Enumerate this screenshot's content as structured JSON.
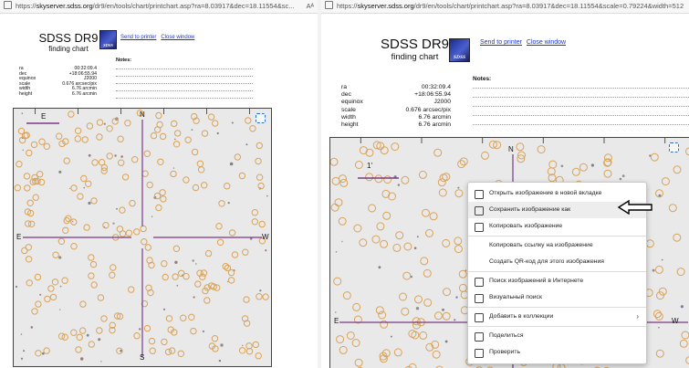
{
  "left": {
    "url": {
      "prefix": "https://",
      "domain": "skyserver.sdss.org",
      "path": "/dr9/en/tools/chart/printchart.asp?ra=8.03917&dec=18.11554&sc...",
      "reader_icon": "Aᴬ"
    },
    "title": "SDSS DR9",
    "subtitle": "finding chart",
    "logo_text": "SDSS",
    "links": [
      "Send to printer",
      "Close window"
    ],
    "notes_label": "Notes:",
    "params": [
      {
        "key": "ra",
        "value": "00:32:09.4"
      },
      {
        "key": "dec",
        "value": "+18:06:55.94"
      },
      {
        "key": "equinox",
        "value": "J2000"
      },
      {
        "key": "scale",
        "value": "0.676 arcsec/pix"
      },
      {
        "key": "width",
        "value": "6.76 arcmin"
      },
      {
        "key": "height",
        "value": "6.76 arcmin"
      }
    ],
    "compass": {
      "n": "N",
      "s": "S",
      "e": "E",
      "w": "W"
    }
  },
  "right": {
    "url": {
      "prefix": "https://",
      "domain": "skyserver.sdss.org",
      "path": "/dr9/en/tools/chart/printchart.asp?ra=8.03917&dec=18.11554&scale=0.79224&width=512"
    },
    "title": "SDSS DR9",
    "subtitle": "finding chart",
    "logo_text": "SDSS",
    "links": [
      "Send to printer",
      "Close window"
    ],
    "notes_label": "Notes:",
    "params": [
      {
        "key": "ra",
        "value": "00:32:09.4"
      },
      {
        "key": "dec",
        "value": "+18:06:55.94"
      },
      {
        "key": "equinox",
        "value": "J2000"
      },
      {
        "key": "scale",
        "value": "0.676 arcsec/pix"
      },
      {
        "key": "width",
        "value": "6.76 arcmin"
      },
      {
        "key": "height",
        "value": "6.76 arcmin"
      }
    ],
    "compass": {
      "n": "N",
      "e": "E",
      "w": "W",
      "one": "1'"
    },
    "context_menu": [
      {
        "label": "Открыть изображение в новой вкладке",
        "icon": "open-new-tab-icon",
        "highlight": false,
        "submenu": false
      },
      {
        "label": "Сохранить изображение как",
        "icon": "save-image-icon",
        "highlight": true,
        "submenu": false
      },
      {
        "label": "Копировать изображение",
        "icon": "copy-image-icon",
        "highlight": false,
        "submenu": false
      },
      {
        "label": "Копировать ссылку на изображение",
        "icon": "",
        "highlight": false,
        "submenu": false
      },
      {
        "label": "Создать QR-код для этого изображения",
        "icon": "",
        "highlight": false,
        "submenu": false
      },
      {
        "label": "Поиск изображений в Интернете",
        "icon": "image-search-icon",
        "highlight": false,
        "submenu": false
      },
      {
        "label": "Визуальный поиск",
        "icon": "visual-search-icon",
        "highlight": false,
        "submenu": false
      },
      {
        "label": "Добавить в коллекции",
        "icon": "collections-icon",
        "highlight": false,
        "submenu": true
      },
      {
        "label": "Поделиться",
        "icon": "share-icon",
        "highlight": false,
        "submenu": false
      },
      {
        "label": "Проверить",
        "icon": "inspect-icon",
        "highlight": false,
        "submenu": false
      }
    ]
  },
  "colors": {
    "circle": "#d9a35a",
    "crosshair": "#7a3a86",
    "link": "#1a37c8",
    "sky": "#e9e9e9"
  }
}
